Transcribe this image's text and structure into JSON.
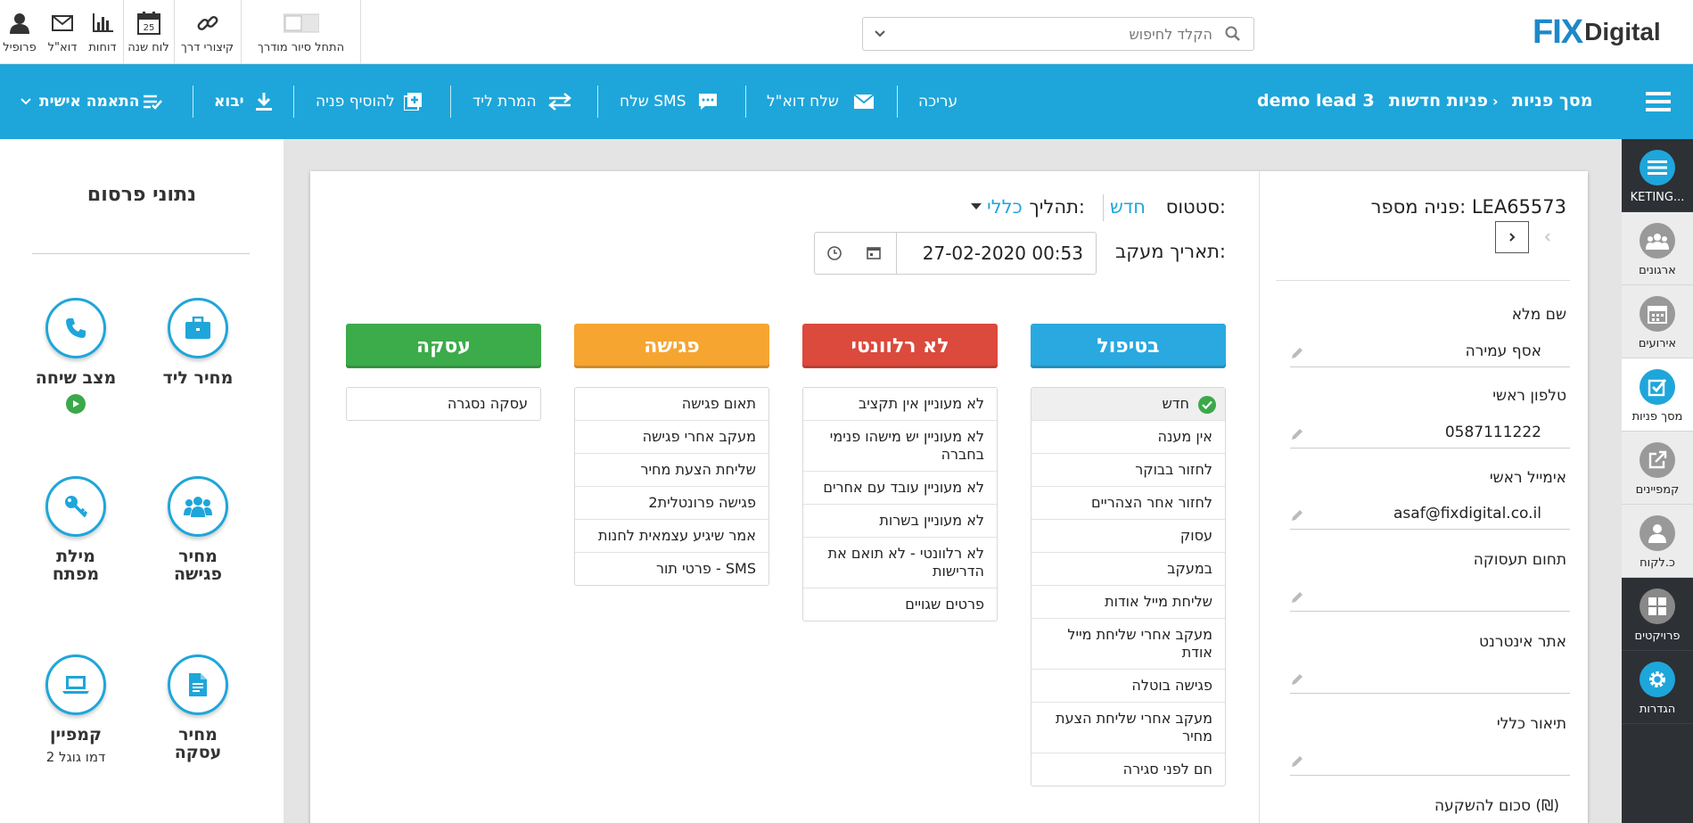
{
  "topbar": {
    "logo_text_left": "FIX",
    "logo_text_right": "Digital",
    "search_placeholder": "הקלד לחיפוש",
    "items": [
      {
        "label": "פרופיל",
        "icon": "user-icon"
      },
      {
        "label": "דוא\"ל",
        "icon": "envelope-icon"
      },
      {
        "label": "דוחות",
        "icon": "bar-chart-icon"
      },
      {
        "label": "לוח שנה",
        "icon": "calendar-icon",
        "badge": "25"
      },
      {
        "label": "קיצורי דרך",
        "icon": "link-icon"
      },
      {
        "label": "התחל סיור מודרך",
        "icon": "toggle-icon"
      }
    ]
  },
  "bluebar": {
    "breadcrumb": [
      "מסך פניות",
      "פניות חדשות",
      "demo lead 3"
    ],
    "actions": {
      "edit": "עריכה",
      "send_email": "שלח דוא\"ל",
      "send_sms": "שלח SMS",
      "convert_lead": "המרת ליד",
      "add_lead": "להוסיף פניה",
      "import": "יבוא",
      "customize": "התאמה אישית"
    },
    "bg_color": "#1ea6da"
  },
  "rail": [
    {
      "label": "KETING...",
      "icon": "menu-icon"
    },
    {
      "label": "ארגונים",
      "icon": "users-icon"
    },
    {
      "label": "אירועים",
      "icon": "calendar-icon"
    },
    {
      "label": "מסך פניות",
      "icon": "checkbox-icon"
    },
    {
      "label": "קמפיינים",
      "icon": "external-link-icon"
    },
    {
      "label": "כ.לקוח",
      "icon": "user-icon"
    },
    {
      "label": "פרויקטים",
      "icon": "grid-icon"
    },
    {
      "label": "הגדרות",
      "icon": "gear-icon"
    }
  ],
  "publicity": {
    "title": "נתוני פרסום",
    "items": [
      {
        "label": "מחיר ליד",
        "icon": "briefcase-icon"
      },
      {
        "label": "מצב שיחה",
        "icon": "phone-icon"
      },
      {
        "label": "מחיר פגישה",
        "icon": "group-icon"
      },
      {
        "label": "מילת מפתח",
        "icon": "key-icon"
      },
      {
        "label": "מחיר עסקה",
        "icon": "document-icon"
      },
      {
        "label": "קמפיין",
        "icon": "laptop-icon",
        "sub": "דמו גוגל 2"
      }
    ]
  },
  "lead": {
    "title": "פניה מספר: LEA65573",
    "fields": [
      {
        "label": "שם מלא",
        "value": "אסף עמירה"
      },
      {
        "label": "טלפון ראשי",
        "value": "0587111222"
      },
      {
        "label": "אימייל ראשי",
        "value": "asaf@fixdigital.co.il"
      },
      {
        "label": "תחום תעסוקה",
        "value": ""
      },
      {
        "label": "אתר אינטרנט",
        "value": ""
      },
      {
        "label": "תיאור כללי",
        "value": ""
      }
    ],
    "investment_label": "סכום להשקעה",
    "currency": "(₪)"
  },
  "status": {
    "status_label": "סטטוס:",
    "status_value": "חדש",
    "process_label": "תהליך:",
    "process_value": "כללי",
    "followup_label": "תאריך מעקב:",
    "followup_value": "27-02-2020 00:53"
  },
  "columns": [
    {
      "title": "בטיפול",
      "color": "#29a9df",
      "items": [
        "חדש",
        "אין מענה",
        "לחזור בבוקר",
        "לחזור אחר הצהריים",
        "עסוק",
        "במעקב",
        "שליחת מייל אודות",
        "מעקב אחרי שליחת מייל אודת",
        "פגישה בוטלה",
        "מעקב אחרי שליחת הצעת מחיר",
        "חם לפני סגירה"
      ],
      "selected_index": 0
    },
    {
      "title": "לא רלוונטי",
      "color": "#db4a3c",
      "items": [
        "לא מעוניין אין תקציב",
        "לא מעוניין יש מישהו פנימי בחברה",
        "לא מעוניין עובד עם אחרים",
        "לא מעוניין בשרות",
        "לא רלוונטי - לא תואם את הדרישות",
        "פרטים שגויים"
      ]
    },
    {
      "title": "פגישה",
      "color": "#f6a531",
      "items": [
        "תאום פגישה",
        "מעקב אחרי פגישה",
        "שליחת הצעת מחיר",
        "פגישה פרונטלית2",
        "אמר שיגיע עצמאית לחנות",
        "SMS - פרטי תור"
      ]
    },
    {
      "title": "עסקה",
      "color": "#3cab4a",
      "items": [
        "עסקה נסגרה"
      ]
    }
  ]
}
